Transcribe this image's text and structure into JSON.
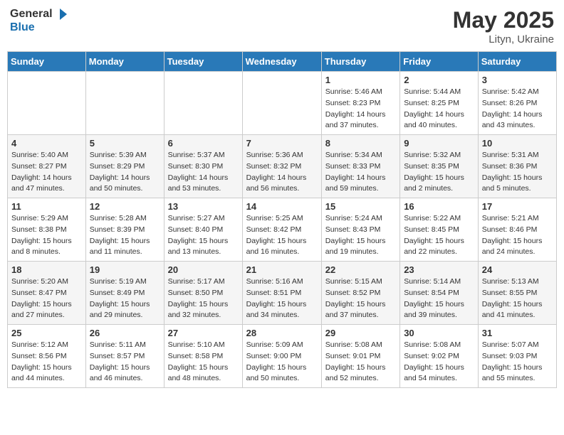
{
  "header": {
    "logo_general": "General",
    "logo_blue": "Blue",
    "month_year": "May 2025",
    "location": "Lityn, Ukraine"
  },
  "weekdays": [
    "Sunday",
    "Monday",
    "Tuesday",
    "Wednesday",
    "Thursday",
    "Friday",
    "Saturday"
  ],
  "weeks": [
    [
      {
        "day": "",
        "sunrise": "",
        "sunset": "",
        "daylight": ""
      },
      {
        "day": "",
        "sunrise": "",
        "sunset": "",
        "daylight": ""
      },
      {
        "day": "",
        "sunrise": "",
        "sunset": "",
        "daylight": ""
      },
      {
        "day": "",
        "sunrise": "",
        "sunset": "",
        "daylight": ""
      },
      {
        "day": "1",
        "sunrise": "Sunrise: 5:46 AM",
        "sunset": "Sunset: 8:23 PM",
        "daylight": "Daylight: 14 hours and 37 minutes."
      },
      {
        "day": "2",
        "sunrise": "Sunrise: 5:44 AM",
        "sunset": "Sunset: 8:25 PM",
        "daylight": "Daylight: 14 hours and 40 minutes."
      },
      {
        "day": "3",
        "sunrise": "Sunrise: 5:42 AM",
        "sunset": "Sunset: 8:26 PM",
        "daylight": "Daylight: 14 hours and 43 minutes."
      }
    ],
    [
      {
        "day": "4",
        "sunrise": "Sunrise: 5:40 AM",
        "sunset": "Sunset: 8:27 PM",
        "daylight": "Daylight: 14 hours and 47 minutes."
      },
      {
        "day": "5",
        "sunrise": "Sunrise: 5:39 AM",
        "sunset": "Sunset: 8:29 PM",
        "daylight": "Daylight: 14 hours and 50 minutes."
      },
      {
        "day": "6",
        "sunrise": "Sunrise: 5:37 AM",
        "sunset": "Sunset: 8:30 PM",
        "daylight": "Daylight: 14 hours and 53 minutes."
      },
      {
        "day": "7",
        "sunrise": "Sunrise: 5:36 AM",
        "sunset": "Sunset: 8:32 PM",
        "daylight": "Daylight: 14 hours and 56 minutes."
      },
      {
        "day": "8",
        "sunrise": "Sunrise: 5:34 AM",
        "sunset": "Sunset: 8:33 PM",
        "daylight": "Daylight: 14 hours and 59 minutes."
      },
      {
        "day": "9",
        "sunrise": "Sunrise: 5:32 AM",
        "sunset": "Sunset: 8:35 PM",
        "daylight": "Daylight: 15 hours and 2 minutes."
      },
      {
        "day": "10",
        "sunrise": "Sunrise: 5:31 AM",
        "sunset": "Sunset: 8:36 PM",
        "daylight": "Daylight: 15 hours and 5 minutes."
      }
    ],
    [
      {
        "day": "11",
        "sunrise": "Sunrise: 5:29 AM",
        "sunset": "Sunset: 8:38 PM",
        "daylight": "Daylight: 15 hours and 8 minutes."
      },
      {
        "day": "12",
        "sunrise": "Sunrise: 5:28 AM",
        "sunset": "Sunset: 8:39 PM",
        "daylight": "Daylight: 15 hours and 11 minutes."
      },
      {
        "day": "13",
        "sunrise": "Sunrise: 5:27 AM",
        "sunset": "Sunset: 8:40 PM",
        "daylight": "Daylight: 15 hours and 13 minutes."
      },
      {
        "day": "14",
        "sunrise": "Sunrise: 5:25 AM",
        "sunset": "Sunset: 8:42 PM",
        "daylight": "Daylight: 15 hours and 16 minutes."
      },
      {
        "day": "15",
        "sunrise": "Sunrise: 5:24 AM",
        "sunset": "Sunset: 8:43 PM",
        "daylight": "Daylight: 15 hours and 19 minutes."
      },
      {
        "day": "16",
        "sunrise": "Sunrise: 5:22 AM",
        "sunset": "Sunset: 8:45 PM",
        "daylight": "Daylight: 15 hours and 22 minutes."
      },
      {
        "day": "17",
        "sunrise": "Sunrise: 5:21 AM",
        "sunset": "Sunset: 8:46 PM",
        "daylight": "Daylight: 15 hours and 24 minutes."
      }
    ],
    [
      {
        "day": "18",
        "sunrise": "Sunrise: 5:20 AM",
        "sunset": "Sunset: 8:47 PM",
        "daylight": "Daylight: 15 hours and 27 minutes."
      },
      {
        "day": "19",
        "sunrise": "Sunrise: 5:19 AM",
        "sunset": "Sunset: 8:49 PM",
        "daylight": "Daylight: 15 hours and 29 minutes."
      },
      {
        "day": "20",
        "sunrise": "Sunrise: 5:17 AM",
        "sunset": "Sunset: 8:50 PM",
        "daylight": "Daylight: 15 hours and 32 minutes."
      },
      {
        "day": "21",
        "sunrise": "Sunrise: 5:16 AM",
        "sunset": "Sunset: 8:51 PM",
        "daylight": "Daylight: 15 hours and 34 minutes."
      },
      {
        "day": "22",
        "sunrise": "Sunrise: 5:15 AM",
        "sunset": "Sunset: 8:52 PM",
        "daylight": "Daylight: 15 hours and 37 minutes."
      },
      {
        "day": "23",
        "sunrise": "Sunrise: 5:14 AM",
        "sunset": "Sunset: 8:54 PM",
        "daylight": "Daylight: 15 hours and 39 minutes."
      },
      {
        "day": "24",
        "sunrise": "Sunrise: 5:13 AM",
        "sunset": "Sunset: 8:55 PM",
        "daylight": "Daylight: 15 hours and 41 minutes."
      }
    ],
    [
      {
        "day": "25",
        "sunrise": "Sunrise: 5:12 AM",
        "sunset": "Sunset: 8:56 PM",
        "daylight": "Daylight: 15 hours and 44 minutes."
      },
      {
        "day": "26",
        "sunrise": "Sunrise: 5:11 AM",
        "sunset": "Sunset: 8:57 PM",
        "daylight": "Daylight: 15 hours and 46 minutes."
      },
      {
        "day": "27",
        "sunrise": "Sunrise: 5:10 AM",
        "sunset": "Sunset: 8:58 PM",
        "daylight": "Daylight: 15 hours and 48 minutes."
      },
      {
        "day": "28",
        "sunrise": "Sunrise: 5:09 AM",
        "sunset": "Sunset: 9:00 PM",
        "daylight": "Daylight: 15 hours and 50 minutes."
      },
      {
        "day": "29",
        "sunrise": "Sunrise: 5:08 AM",
        "sunset": "Sunset: 9:01 PM",
        "daylight": "Daylight: 15 hours and 52 minutes."
      },
      {
        "day": "30",
        "sunrise": "Sunrise: 5:08 AM",
        "sunset": "Sunset: 9:02 PM",
        "daylight": "Daylight: 15 hours and 54 minutes."
      },
      {
        "day": "31",
        "sunrise": "Sunrise: 5:07 AM",
        "sunset": "Sunset: 9:03 PM",
        "daylight": "Daylight: 15 hours and 55 minutes."
      }
    ]
  ]
}
